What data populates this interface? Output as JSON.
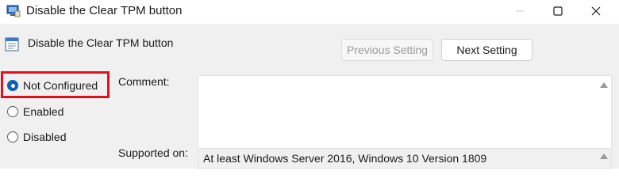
{
  "window": {
    "title": "Disable the Clear TPM button",
    "controls": [
      "minimize-icon",
      "maximize-icon",
      "close-icon"
    ]
  },
  "header": {
    "policy_name": "Disable the Clear TPM button",
    "previous_label": "Previous Setting",
    "next_label": "Next Setting"
  },
  "options": {
    "selected": "Not Configured",
    "items": [
      {
        "label": "Not Configured",
        "checked": true
      },
      {
        "label": "Enabled",
        "checked": false
      },
      {
        "label": "Disabled",
        "checked": false
      }
    ]
  },
  "fields": {
    "comment_label": "Comment:",
    "comment_value": "",
    "supported_label": "Supported on:",
    "supported_value": "At least Windows Server 2016, Windows 10 Version 1809"
  },
  "colors": {
    "accent": "#0f5fb8",
    "highlight": "#e0101c",
    "dialog_bg": "#f0f0f0"
  }
}
